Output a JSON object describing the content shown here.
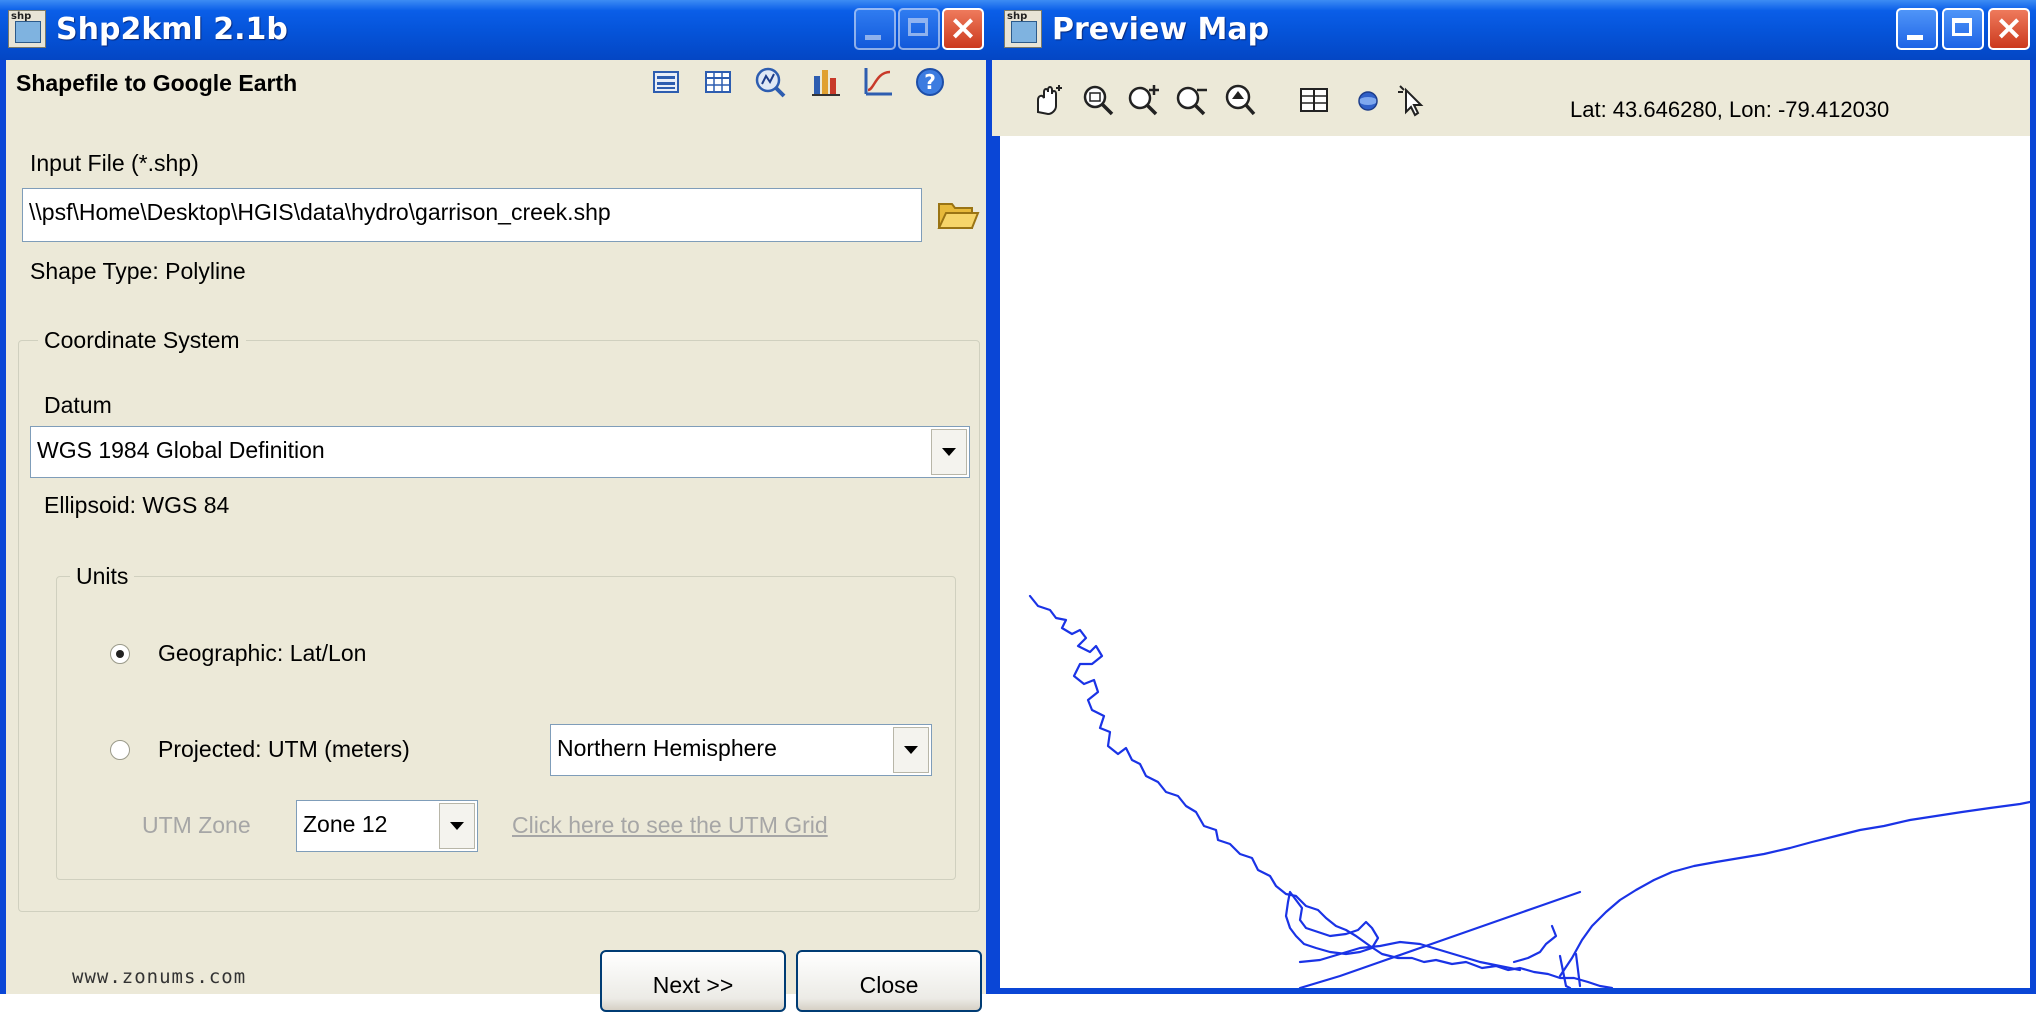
{
  "left_window": {
    "title": "Shp2kml 2.1b",
    "subtitle": "Shapefile to Google Earth",
    "toolbar_icons": [
      "list-icon",
      "table-icon",
      "chart-icon",
      "bar-chart-icon",
      "graph-icon",
      "help-icon"
    ],
    "input_file": {
      "label": "Input File (*.shp)",
      "value": "\\\\psf\\Home\\Desktop\\HGIS\\data\\hydro\\garrison_creek.shp"
    },
    "shape_type": "Shape Type: Polyline",
    "coordinate_system": {
      "legend": "Coordinate System",
      "datum_label": "Datum",
      "datum_value": "WGS 1984 Global Definition",
      "ellipsoid": "Ellipsoid: WGS 84"
    },
    "units": {
      "legend": "Units",
      "geographic_label": "Geographic: Lat/Lon",
      "projected_label": "Projected: UTM (meters)",
      "selected": "geographic",
      "hemisphere_value": "Northern Hemisphere",
      "utm_zone_label": "UTM Zone",
      "utm_zone_value": "Zone 12",
      "utm_grid_link": "Click here to see the UTM Grid"
    },
    "footer_url": "www.zonums.com",
    "next_label": "Next >>",
    "close_label": "Close"
  },
  "right_window": {
    "title": "Preview Map",
    "toolbar_icons": [
      "pan-icon",
      "zoom-extent-icon",
      "zoom-in-icon",
      "zoom-out-icon",
      "zoom-previous-icon",
      "attribute-table-icon",
      "globe-icon",
      "select-pointer-icon"
    ],
    "coordinates": "Lat: 43.646280, Lon: -79.412030"
  },
  "colors": {
    "title_bar": "#0553d8",
    "window_face": "#ece9d8",
    "map_line": "#1a33e6",
    "close_button": "#cc3a1e"
  }
}
